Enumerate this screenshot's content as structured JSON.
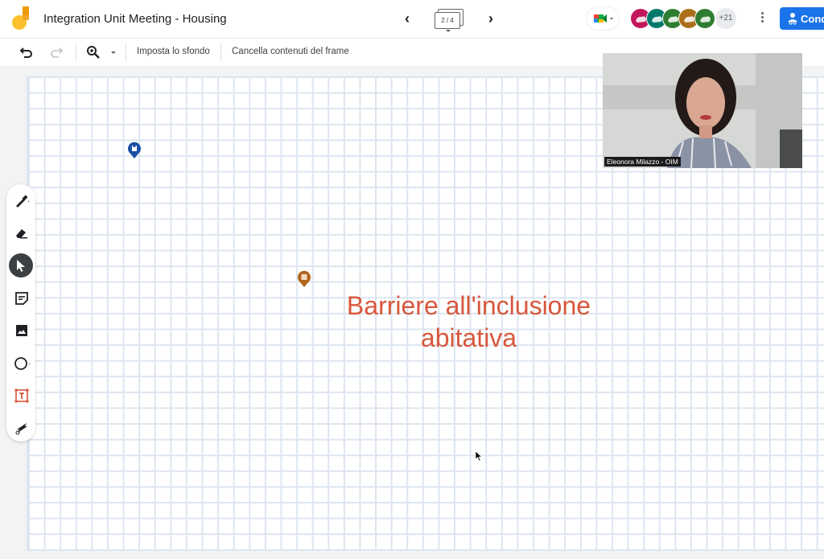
{
  "header": {
    "title": "Integration Unit Meeting - Housing",
    "frame_indicator": "2 / 4",
    "share_label": "Cond",
    "avatars": [
      {
        "color": "#c2185b",
        "icon": "animal-avatar"
      },
      {
        "color": "#00796b",
        "icon": "animal-avatar"
      },
      {
        "color": "#2e7d32",
        "icon": "animal-avatar"
      },
      {
        "color": "#ad6e1a",
        "icon": "animal-avatar"
      },
      {
        "color": "#2e7d32",
        "icon": "animal-avatar"
      }
    ],
    "more_participants": "+21",
    "accent_color": "#1a73e8"
  },
  "toolbar": {
    "set_background": "Imposta lo sfondo",
    "clear_frame": "Cancella contenuti del frame"
  },
  "side_tools": [
    {
      "name": "pen",
      "active": false
    },
    {
      "name": "eraser",
      "active": false
    },
    {
      "name": "select",
      "active": true
    },
    {
      "name": "sticky-note",
      "active": false
    },
    {
      "name": "image",
      "active": false
    },
    {
      "name": "circle",
      "active": false
    },
    {
      "name": "text-box",
      "active": false
    },
    {
      "name": "laser",
      "active": false
    }
  ],
  "canvas": {
    "text_line1": "Barriere all'inclusione",
    "text_line2": "abitativa",
    "text_color": "#d8573c"
  },
  "video": {
    "participant_name": "Eleonora Milazzo - OIM"
  }
}
